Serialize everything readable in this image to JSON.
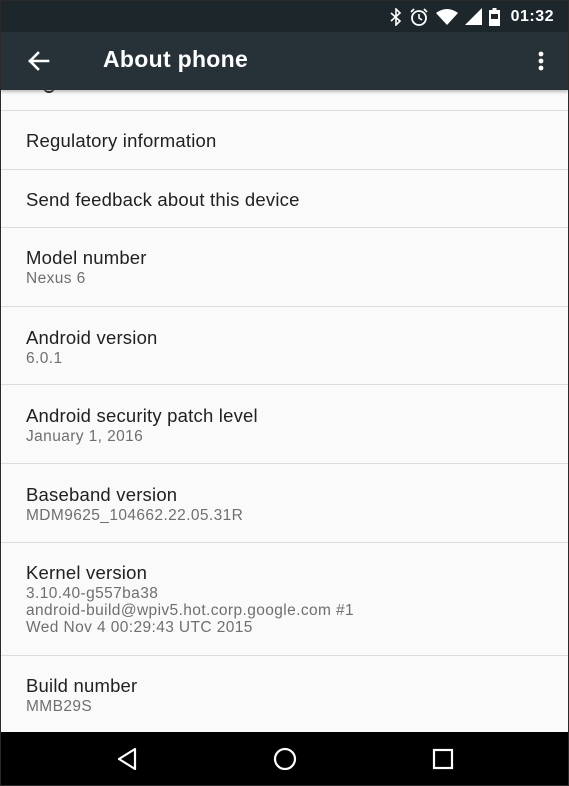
{
  "status_bar": {
    "time": "01:32",
    "icons": [
      "bluetooth-icon",
      "alarm-icon",
      "wifi-icon",
      "cellular-signal-icon",
      "battery-icon"
    ]
  },
  "app_bar": {
    "title": "About phone",
    "back_icon": "arrow-back-icon",
    "overflow_icon": "more-vert-icon",
    "color": "#263238"
  },
  "list": [
    {
      "title": "Regulatory information"
    },
    {
      "title": "Send feedback about this device"
    },
    {
      "title": "Model number",
      "subtitle": [
        "Nexus 6"
      ]
    },
    {
      "title": "Android version",
      "subtitle": [
        "6.0.1"
      ]
    },
    {
      "title": "Android security patch level",
      "subtitle": [
        "January 1, 2016"
      ]
    },
    {
      "title": "Baseband version",
      "subtitle": [
        "MDM9625_104662.22.05.31R"
      ]
    },
    {
      "title": "Kernel version",
      "subtitle": [
        "3.10.40-g557ba38",
        "android-build@wpiv5.hot.corp.google.com #1",
        "Wed Nov 4 00:29:43 UTC 2015"
      ]
    },
    {
      "title": "Build number",
      "subtitle": [
        "MMB29S"
      ]
    }
  ],
  "nav_bar": {
    "buttons": [
      "back-triangle-icon",
      "home-circle-icon",
      "recents-square-icon"
    ]
  }
}
